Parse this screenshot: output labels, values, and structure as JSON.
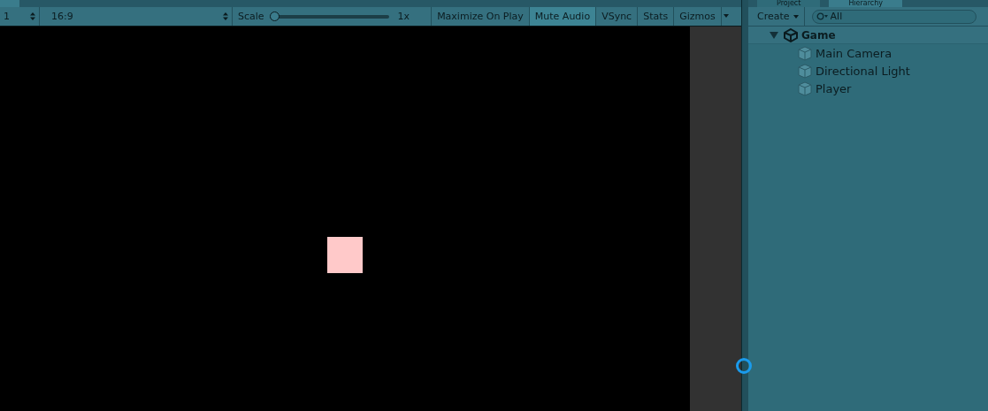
{
  "game_toolbar": {
    "display": "1",
    "aspect": "16:9",
    "scale": {
      "label": "Scale",
      "level": 0.0,
      "reading": "1x"
    },
    "toggles": [
      {
        "label": "Maximize On Play",
        "selected": false
      },
      {
        "label": "Mute Audio",
        "selected": true
      },
      {
        "label": "VSync",
        "selected": false
      },
      {
        "label": "Stats",
        "selected": false
      },
      {
        "label": "Gizmos",
        "selected": false
      }
    ]
  },
  "right_tabs": [
    {
      "label": "Project",
      "selected": false
    },
    {
      "label": "Hierarchy",
      "selected": true
    }
  ],
  "hierarchy": {
    "create": "Create",
    "search_placeholder": "All",
    "tree": [
      {
        "label": "Game",
        "expanded": true,
        "children": [
          {
            "label": "Main Camera"
          },
          {
            "label": "Directional Light"
          },
          {
            "label": "Player"
          }
        ]
      }
    ]
  }
}
